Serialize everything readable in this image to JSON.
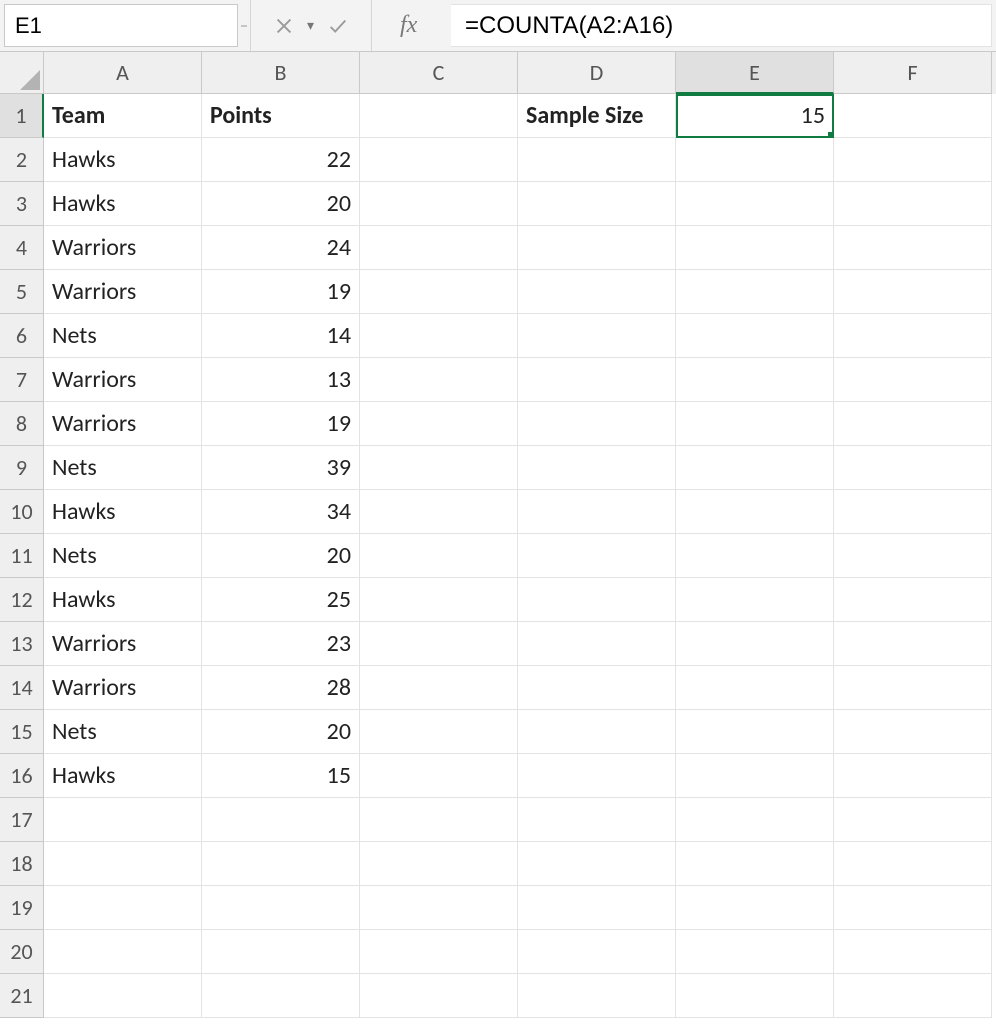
{
  "formula_bar": {
    "active_cell": "E1",
    "formula": "=COUNTA(A2:A16)",
    "fx_label": "fx"
  },
  "columns": [
    "A",
    "B",
    "C",
    "D",
    "E",
    "F"
  ],
  "active_column": "E",
  "row_count": 21,
  "active_row": 1,
  "headers": {
    "A1": "Team",
    "B1": "Points",
    "D1": "Sample Size"
  },
  "E1": "15",
  "data_rows": [
    {
      "team": "Hawks",
      "points": 22
    },
    {
      "team": "Hawks",
      "points": 20
    },
    {
      "team": "Warriors",
      "points": 24
    },
    {
      "team": "Warriors",
      "points": 19
    },
    {
      "team": "Nets",
      "points": 14
    },
    {
      "team": "Warriors",
      "points": 13
    },
    {
      "team": "Warriors",
      "points": 19
    },
    {
      "team": "Nets",
      "points": 39
    },
    {
      "team": "Hawks",
      "points": 34
    },
    {
      "team": "Nets",
      "points": 20
    },
    {
      "team": "Hawks",
      "points": 25
    },
    {
      "team": "Warriors",
      "points": 23
    },
    {
      "team": "Warriors",
      "points": 28
    },
    {
      "team": "Nets",
      "points": 20
    },
    {
      "team": "Hawks",
      "points": 15
    }
  ]
}
